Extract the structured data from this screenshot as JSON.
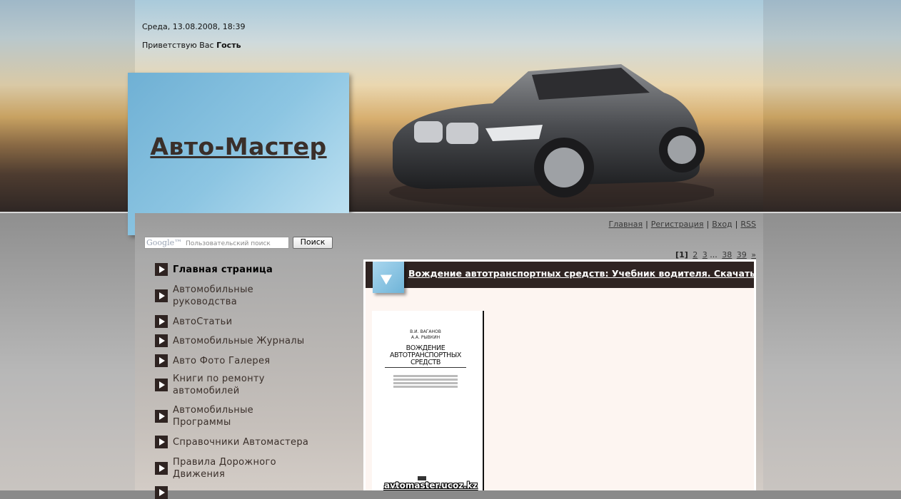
{
  "header": {
    "date": "Среда, 13.08.2008, 18:39",
    "greeting_prefix": "Приветствую Вас",
    "greeting_user": "Гость",
    "site_title": "Авто-Мастер"
  },
  "top_nav": {
    "items": [
      "Главная",
      "Регистрация",
      "Вход",
      "RSS"
    ]
  },
  "search": {
    "logo_text": "Google™",
    "placeholder": "Пользовательский поиск",
    "button_label": "Поиск"
  },
  "pagination": {
    "current": "1",
    "pages": [
      "2",
      "3"
    ],
    "ellipsis": "...",
    "more_pages": [
      "38",
      "39"
    ],
    "next": "»"
  },
  "sidebar": {
    "items": [
      {
        "label": "Главная страница"
      },
      {
        "label": "Автомобильные руководства"
      },
      {
        "label": "АвтоСтатьи"
      },
      {
        "label": "Автомобильные Журналы"
      },
      {
        "label": "Авто Фото Галерея"
      },
      {
        "label": "Книги по ремонту автомобилей"
      },
      {
        "label": "Автомобильные Программы"
      },
      {
        "label": "Справочники Автомастера"
      },
      {
        "label": "Правила Дорожного Движения"
      }
    ]
  },
  "post": {
    "title": "Вождение автотранспортных средств: Учебник водителя. Скачать",
    "book_authors": "В.И. ВАГАНОВ\nА.А. РЫВКИН",
    "book_title": "ВОЖДЕНИЕ АВТОТРАНСПОРТНЫХ СРЕДСТВ",
    "image_caption": "avtomaster.ucoz.kz"
  },
  "colors": {
    "accent_dark": "#2f2422",
    "logo_blue": "#8cc5e2",
    "post_bg": "#fdf5f1"
  }
}
